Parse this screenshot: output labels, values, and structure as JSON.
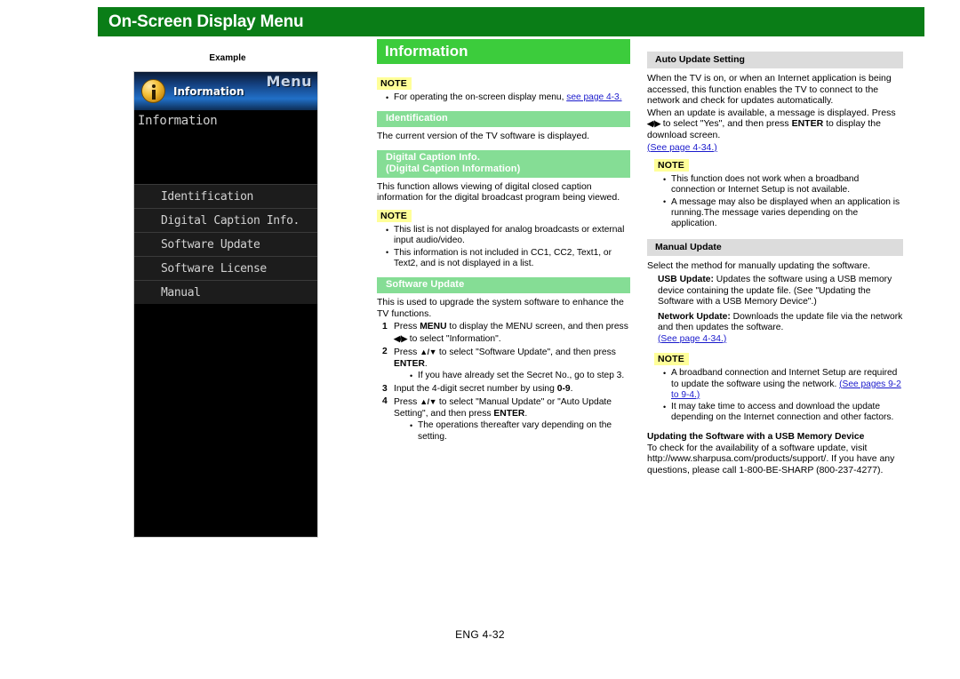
{
  "header": {
    "title": "On-Screen Display Menu",
    "bar_color": "#0a7d17"
  },
  "example": {
    "label": "Example",
    "tv_menu": {
      "menu_word": "Menu",
      "header_label": "Information",
      "icon": "info-circle-icon",
      "screen_title": "Information",
      "items": [
        "Identification",
        "Digital Caption Info.",
        "Software Update",
        "Software License",
        "Manual"
      ]
    }
  },
  "middle": {
    "banner": "Information",
    "banner_color": "#3ccc3c",
    "note_label": "NOTE",
    "intro_note_bullets": [
      {
        "text": "For operating the on-screen display menu, ",
        "link": "see page 4-3."
      }
    ],
    "sections": [
      {
        "heading": "Identification",
        "heading_line2": "",
        "body": "The current version of the TV software is displayed."
      },
      {
        "heading": "Digital Caption Info.",
        "heading_line2": "(Digital Caption Information)",
        "body": "This function allows viewing of digital closed caption information for the digital broadcast program being viewed.",
        "note_bullets": [
          "This list is not displayed for analog broadcasts or external input audio/video.",
          "This information is not included in CC1, CC2, Text1, or Text2, and is not displayed in a list."
        ]
      },
      {
        "heading": "Software Update",
        "heading_line2": "",
        "body": "This is used to upgrade the system software to enhance the TV functions."
      }
    ],
    "steps": [
      {
        "pre": "Press ",
        "kbd1": "MENU",
        "mid": " to display the MENU screen, and then press ",
        "kbd2": "◀/▶",
        "post": " to select \"Information\"."
      },
      {
        "pre": "Press ",
        "kbd1": "▲/▼",
        "mid": " to select \"Software Update\", and then press ",
        "kbd2": "ENTER",
        "post": ".",
        "sub_bullets": [
          "If you have already set the Secret No., go to step 3."
        ]
      },
      {
        "pre": "Input the 4-digit secret number by using ",
        "kbd1": "0-9",
        "mid": "",
        "kbd2": "",
        "post": "."
      },
      {
        "pre": "Press ",
        "kbd1": "▲/▼",
        "mid": " to select \"Manual Update\" or \"Auto Update Setting\", and then press ",
        "kbd2": "ENTER",
        "post": ".",
        "sub_bullets": [
          "The operations thereafter vary depending on the setting."
        ]
      }
    ]
  },
  "right": {
    "note_label": "NOTE",
    "auto_update": {
      "heading": "Auto Update Setting",
      "para1": "When the TV is on, or when an Internet application is being accessed, this function enables the TV to connect to the network and check for updates automatically.",
      "para2_pre": "When an update is available, a message is displayed. Press ",
      "para2_kbd1": "◀/▶",
      "para2_mid": " to select \"Yes\", and then press ",
      "para2_kbd2": "ENTER",
      "para2_post": " to display the download screen.",
      "link": "(See page 4-34.)",
      "note_bullets": [
        "This function does not work when a broadband connection or Internet Setup is not available.",
        "A message may also be displayed when an application is running.The message varies depending on the application."
      ]
    },
    "manual_update": {
      "heading": "Manual Update",
      "intro": "Select the method for manually updating the software.",
      "definitions": [
        {
          "term": "USB Update:",
          "desc": " Updates the software using a USB memory device containing the update file. (See \"Updating the Software with a USB Memory Device\".)"
        },
        {
          "term": "Network Update:",
          "desc": " Downloads the update file via the network and then updates the software.",
          "link": "(See page 4-34.)"
        }
      ],
      "note_bullets": [
        {
          "text": "A broadband connection and Internet Setup are required to update the software using the network. ",
          "link": "(See pages 9-2 to 9-4.)"
        },
        {
          "text": "It may take time to access and download the update depending on the Internet connection and other factors.",
          "link": ""
        }
      ],
      "usb_section": {
        "heading": "Updating the Software with a USB Memory Device",
        "body": "To check for the availability of a software update, visit http://www.sharpusa.com/products/support/. If you have any questions, please call 1-800-BE-SHARP (800-237-4277)."
      }
    }
  },
  "footer": {
    "text": "ENG 4-32"
  }
}
